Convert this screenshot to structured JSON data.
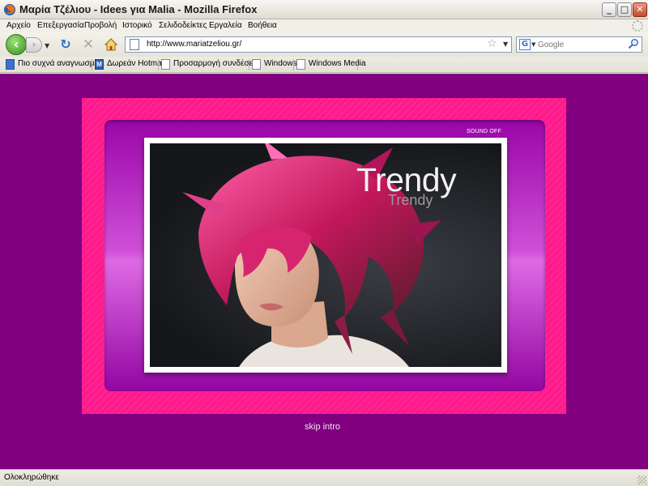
{
  "window": {
    "title": "Μαρία Τζέλιου - Idees για Malia - Mozilla Firefox"
  },
  "menu": {
    "items": [
      "Αρχείο",
      "Επεξεργασία",
      "Προβολή",
      "Ιστορικό",
      "Σελιδοδείκτες",
      "Εργαλεία",
      "Βοήθεια"
    ]
  },
  "navigation": {
    "url": "http://www.mariatzeliou.gr/",
    "search_placeholder": "Google"
  },
  "bookmarks": [
    {
      "label": "Πιο συχνά αναγνωσμέ...",
      "icon": "bookmark-blue-icon"
    },
    {
      "label": "Δωρεάν Hotmail",
      "icon": "msn-icon"
    },
    {
      "label": "Προσαρμογή συνδέσε...",
      "icon": "page-icon"
    },
    {
      "label": "Windows",
      "icon": "page-icon"
    },
    {
      "label": "Windows Media",
      "icon": "page-icon"
    }
  ],
  "page": {
    "sound_toggle": "SOUND OFF",
    "headline": "Trendy",
    "headline_echo": "Trendy",
    "skip_link": "skip intro",
    "colors": {
      "background": "#800080",
      "frame": "#ff1a8c",
      "panel": "#cf4fd8"
    }
  },
  "status": {
    "text": "Ολοκληρώθηκε"
  }
}
